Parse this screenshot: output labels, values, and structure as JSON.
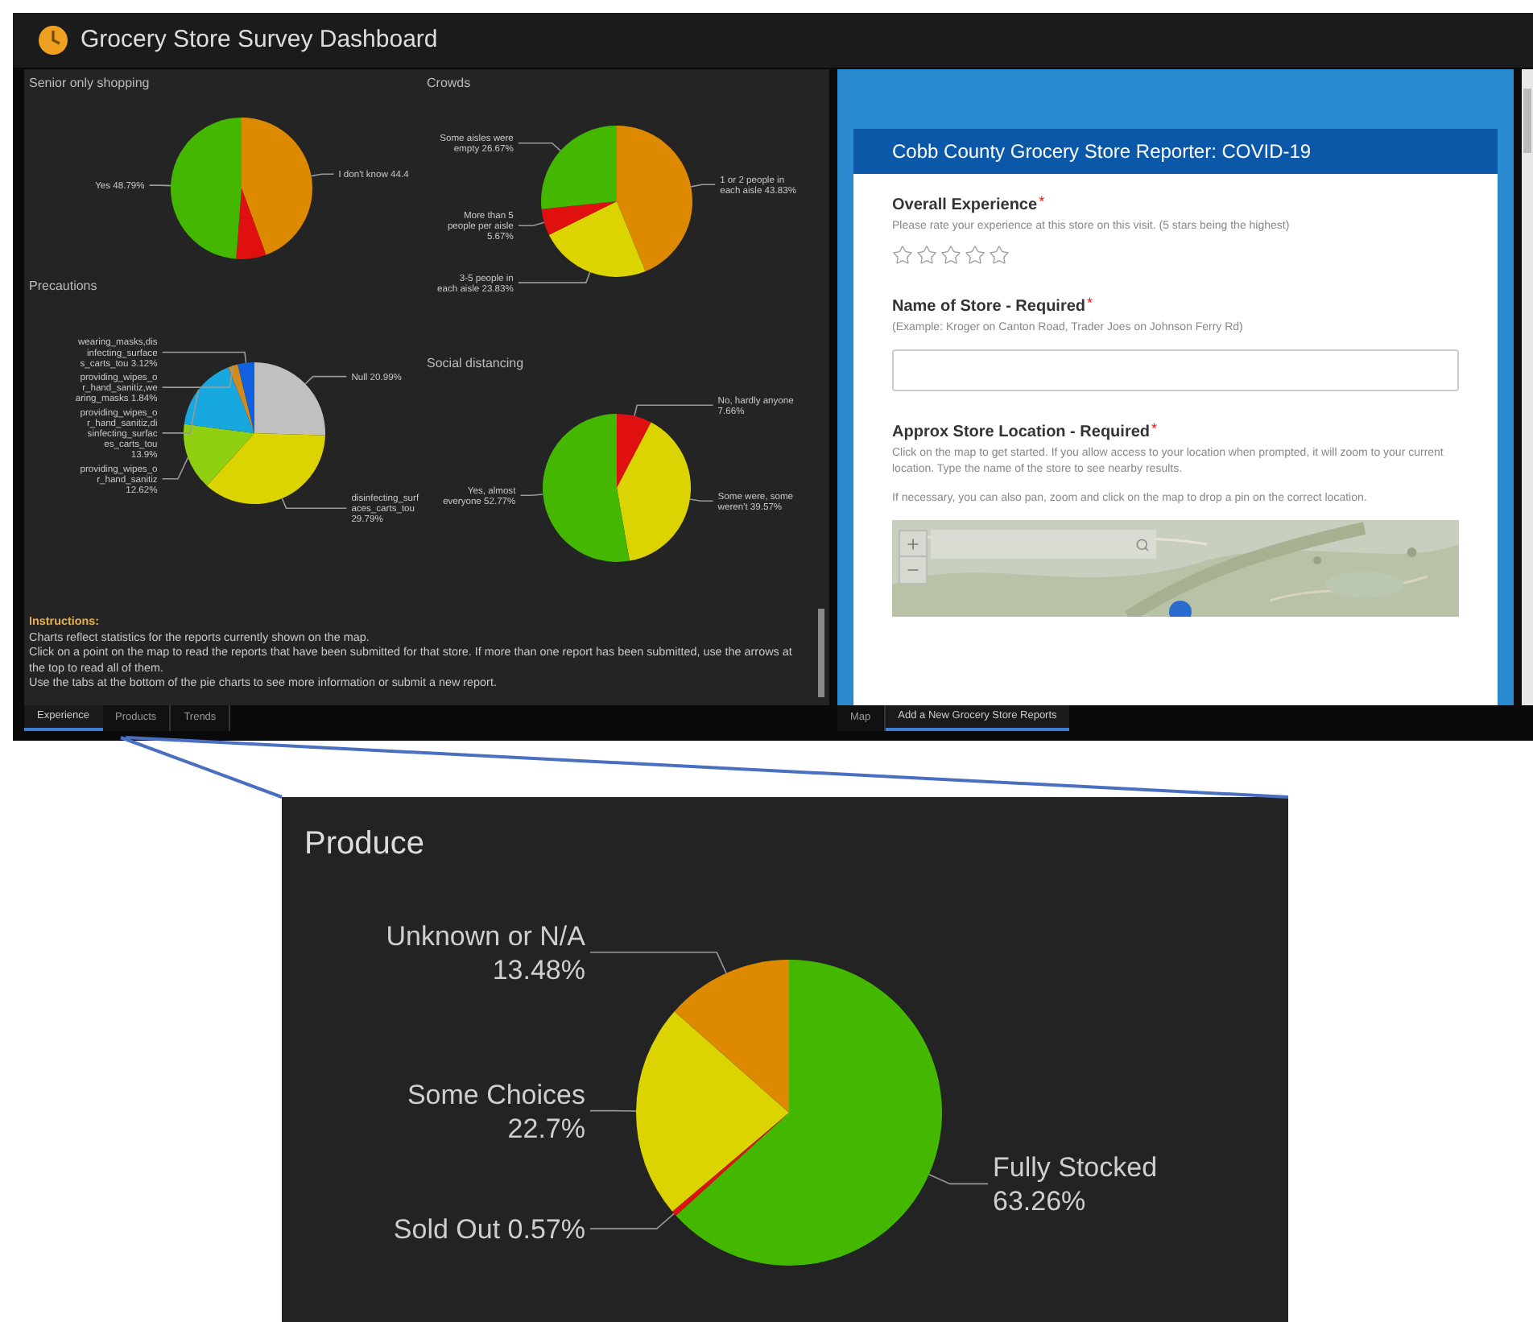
{
  "header": {
    "title": "Grocery Store Survey Dashboard"
  },
  "charts": [
    {
      "title": "Senior only shopping",
      "chart_data": {
        "type": "pie",
        "categories": [
          "I don't know",
          null,
          "Yes"
        ],
        "values": [
          44.4,
          6.81,
          48.79
        ],
        "value_labels": [
          "44.4",
          null,
          "48.79%"
        ],
        "colors": [
          "#dd8a00",
          "#e01010",
          "#44b800"
        ]
      }
    },
    {
      "title": "Crowds",
      "chart_data": {
        "type": "pie",
        "categories": [
          "1 or 2 people in each aisle",
          "3-5 people in each aisle",
          "More than 5 people per aisle",
          "Some aisles were empty"
        ],
        "values": [
          43.83,
          23.83,
          5.67,
          26.67
        ],
        "value_labels": [
          "43.83%",
          "23.83%",
          "5.67%",
          "26.67%"
        ],
        "colors": [
          "#dd8a00",
          "#dcd400",
          "#e01010",
          "#44b800"
        ]
      }
    },
    {
      "title": "Precautions",
      "chart_data": {
        "type": "pie",
        "categories": [
          "Null",
          "disinfecting_surfaces_carts_tou",
          "providing_wipes_or_hand_sanitiz",
          "providing_wipes_or_hand_sanitiz,disinfecting_surfaces_carts_tou",
          "providing_wipes_or_hand_sanitiz,wearing_masks",
          "wearing_masks,disinfecting_surfaces_carts_tou"
        ],
        "values": [
          20.99,
          29.79,
          12.62,
          13.9,
          1.84,
          3.12
        ],
        "value_labels": [
          "20.99%",
          "29.79%",
          "12.62%",
          "13.9%",
          "1.84%",
          "3.12%"
        ],
        "colors": [
          "#c0c0c0",
          "#dcd400",
          "#90d010",
          "#18a8e0",
          "#d08a20",
          "#1060e0"
        ]
      }
    },
    {
      "title": "Social distancing",
      "chart_data": {
        "type": "pie",
        "categories": [
          "No, hardly anyone",
          "Some were, some weren't",
          "Yes, almost everyone"
        ],
        "values": [
          7.66,
          39.57,
          52.77
        ],
        "value_labels": [
          "7.66%",
          "39.57%",
          "52.77%"
        ],
        "colors": [
          "#e01010",
          "#dcd400",
          "#44b800"
        ]
      }
    }
  ],
  "instructions": {
    "heading": "Instructions:",
    "paragraphs": [
      "Charts reflect statistics for the reports currently shown on the map.",
      "Click on a point on the map to read the reports that have been submitted for that store. If more than one report has been submitted, use the arrows at the top to read all of them.",
      "Use the tabs at the bottom of the pie charts to see more information or submit a new report."
    ]
  },
  "left_tabs": [
    {
      "label": "Experience",
      "selected": true
    },
    {
      "label": "Products",
      "selected": false
    },
    {
      "label": "Trends",
      "selected": false
    }
  ],
  "form": {
    "title": "Cobb County Grocery Store Reporter: COVID-19",
    "fields": [
      {
        "kind": "rating",
        "label": "Overall Experience",
        "required_mark": "*",
        "hint": "Please rate your experience at this store on this visit. (5 stars being the highest)",
        "stars": 0
      },
      {
        "kind": "text",
        "label": "Name of Store - Required",
        "required_mark": "*",
        "hint": "(Example: Kroger on Canton Road, Trader Joes on Johnson Ferry Rd)"
      },
      {
        "kind": "map",
        "label": "Approx Store Location - Required",
        "required_mark": "*",
        "hint": "Click on the map to get started. If you allow access to your location when prompted, it will zoom to your current location. Type the name of the store to see nearby results.",
        "hint_2": "If necessary, you can also pan, zoom and click on the map to drop a pin on the correct location."
      }
    ]
  },
  "right_tabs": [
    {
      "label": "Map",
      "selected": false
    },
    {
      "label": "Add a New Grocery Store Reports",
      "selected": true
    }
  ],
  "callout": {
    "title": "Produce",
    "chart_data": {
      "type": "pie",
      "categories": [
        "Fully Stocked",
        "Sold Out",
        "Some Choices",
        "Unknown or N/A"
      ],
      "values": [
        63.26,
        0.57,
        22.7,
        13.48
      ],
      "value_labels": [
        "63.26%",
        "0.57%",
        "22.7%",
        "13.48%"
      ],
      "colors": [
        "#44b800",
        "#e01010",
        "#dcd400",
        "#dd8a00"
      ]
    }
  }
}
